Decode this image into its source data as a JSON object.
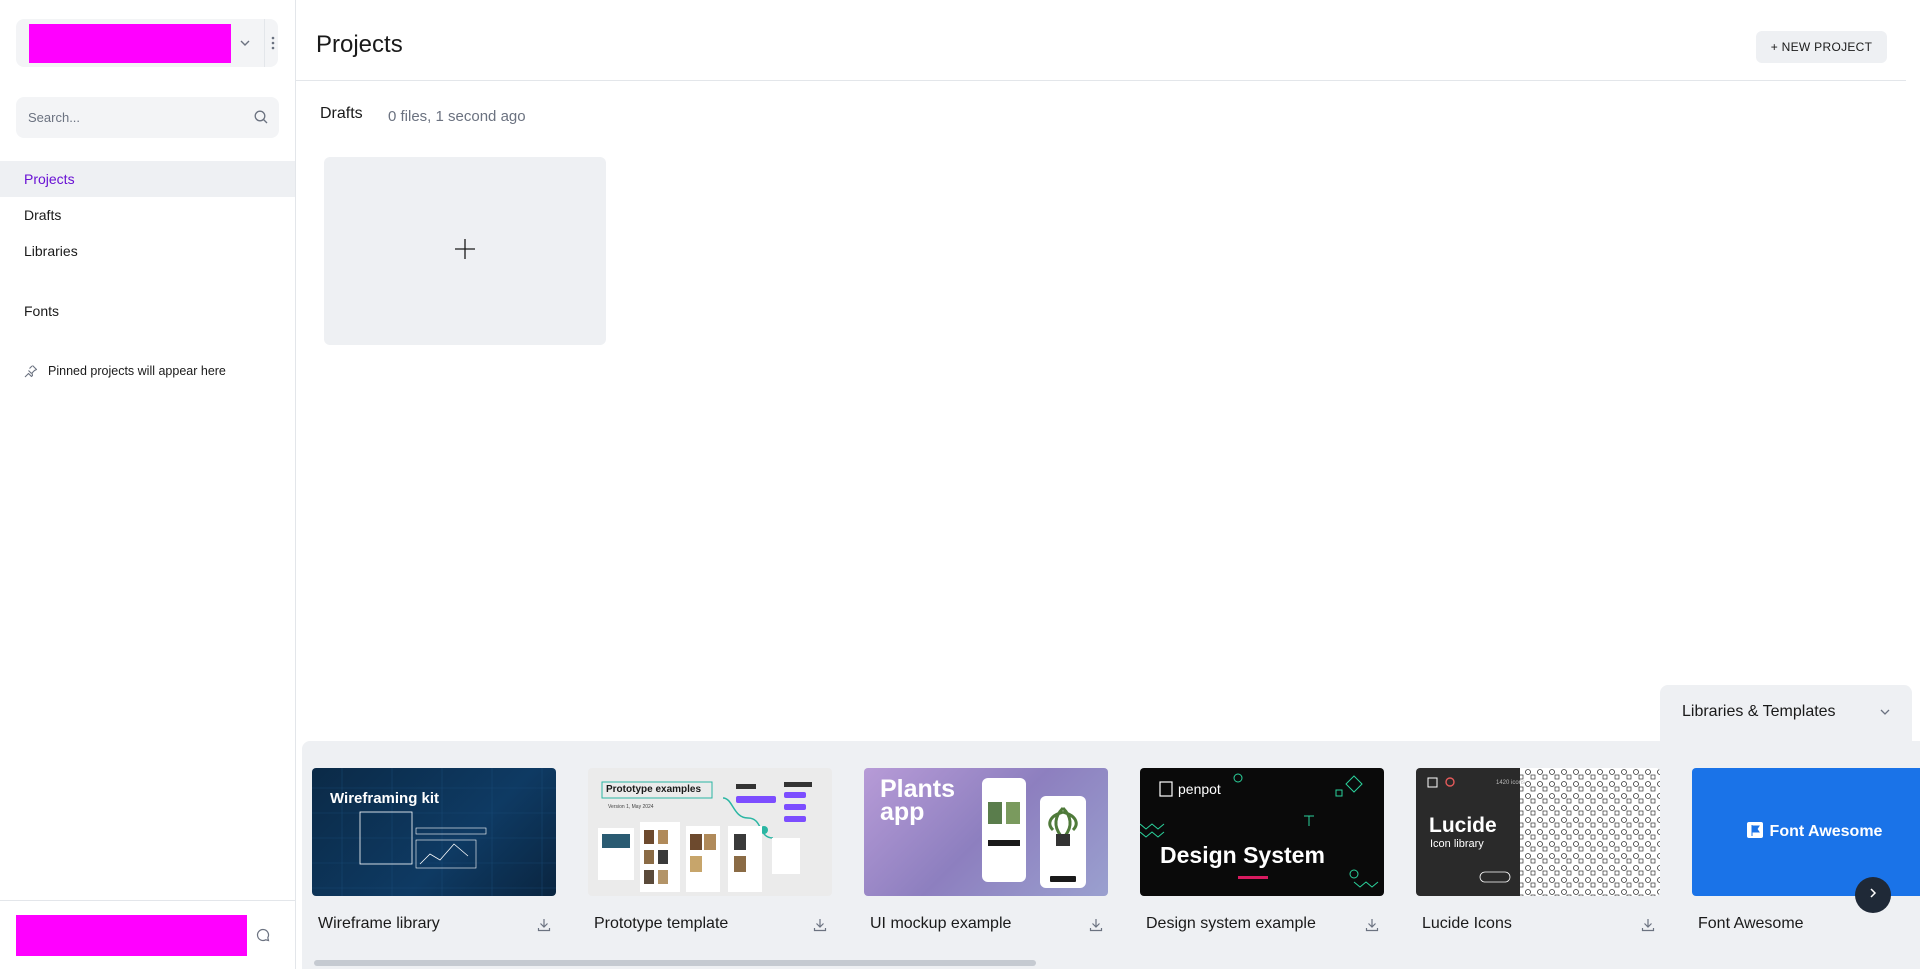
{
  "sidebar": {
    "team_swatch_color": "#ff00ff",
    "search": {
      "placeholder": "Search..."
    },
    "nav": [
      {
        "label": "Projects",
        "active": true
      },
      {
        "label": "Drafts",
        "active": false
      },
      {
        "label": "Libraries",
        "active": false
      },
      {
        "label": "Fonts",
        "active": false
      }
    ],
    "pinned_hint": "Pinned projects will appear here",
    "profile_swatch_color": "#ff00ff"
  },
  "header": {
    "title": "Projects",
    "new_project_label": "+ NEW PROJECT"
  },
  "drafts": {
    "title": "Drafts",
    "meta": "0 files, 1 second ago"
  },
  "libraries_templates": {
    "label": "Libraries & Templates",
    "cards": [
      {
        "name": "Wireframe library",
        "thumb_title": "Wireframing kit"
      },
      {
        "name": "Prototype template",
        "thumb_title": "Prototype examples",
        "thumb_sub": "Version 1, May 2024"
      },
      {
        "name": "UI mockup example",
        "thumb_title": "Plants app"
      },
      {
        "name": "Design system example",
        "thumb_brand": "penpot",
        "thumb_title": "Design System"
      },
      {
        "name": "Lucide Icons",
        "thumb_title": "Lucide",
        "thumb_sub": "Icon library",
        "thumb_count": "1420 icons"
      },
      {
        "name": "Font Awesome",
        "thumb_title": "Font Awesome"
      }
    ]
  },
  "colors": {
    "accent": "#6911d4",
    "placeholder_magenta": "#ff00ff"
  }
}
